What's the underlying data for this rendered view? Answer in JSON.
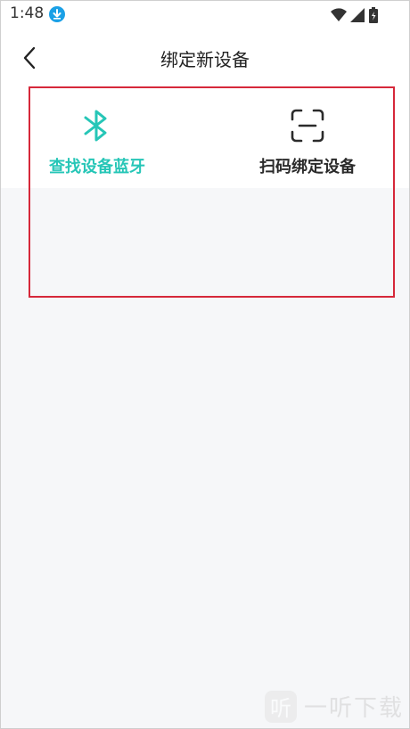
{
  "status_bar": {
    "time": "1:48"
  },
  "header": {
    "title": "绑定新设备"
  },
  "options": [
    {
      "label": "查找设备蓝牙",
      "icon": "bluetooth-icon",
      "color": "#26c6b7"
    },
    {
      "label": "扫码绑定设备",
      "icon": "scan-icon",
      "color": "#2b2b2b"
    }
  ],
  "highlight": {
    "color": "#d6283a"
  },
  "watermark": {
    "badge": "听",
    "text": "一听下载"
  }
}
